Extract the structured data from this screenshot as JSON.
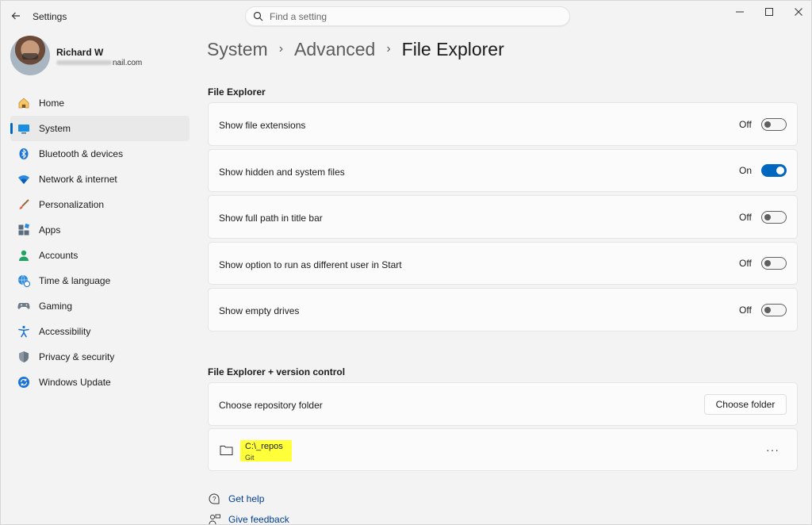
{
  "window": {
    "title": "Settings",
    "search_placeholder": "Find a setting"
  },
  "profile": {
    "name": "Richard W",
    "email_suffix": "nail.com"
  },
  "sidebar": {
    "items": [
      {
        "label": "Home",
        "icon": "home-icon",
        "active": false
      },
      {
        "label": "System",
        "icon": "system-icon",
        "active": true
      },
      {
        "label": "Bluetooth & devices",
        "icon": "bluetooth-icon",
        "active": false
      },
      {
        "label": "Network & internet",
        "icon": "wifi-icon",
        "active": false
      },
      {
        "label": "Personalization",
        "icon": "brush-icon",
        "active": false
      },
      {
        "label": "Apps",
        "icon": "apps-icon",
        "active": false
      },
      {
        "label": "Accounts",
        "icon": "accounts-icon",
        "active": false
      },
      {
        "label": "Time & language",
        "icon": "globe-clock-icon",
        "active": false
      },
      {
        "label": "Gaming",
        "icon": "gamepad-icon",
        "active": false
      },
      {
        "label": "Accessibility",
        "icon": "accessibility-icon",
        "active": false
      },
      {
        "label": "Privacy & security",
        "icon": "shield-icon",
        "active": false
      },
      {
        "label": "Windows Update",
        "icon": "update-icon",
        "active": false
      }
    ]
  },
  "breadcrumb": {
    "items": [
      "System",
      "Advanced",
      "File Explorer"
    ],
    "separator": "›"
  },
  "file_explorer": {
    "section_title": "File Explorer",
    "settings": [
      {
        "label": "Show file extensions",
        "state": "Off",
        "on": false
      },
      {
        "label": "Show hidden and system files",
        "state": "On",
        "on": true
      },
      {
        "label": "Show full path in title bar",
        "state": "Off",
        "on": false
      },
      {
        "label": "Show option to run as different user in Start",
        "state": "Off",
        "on": false
      },
      {
        "label": "Show empty drives",
        "state": "Off",
        "on": false
      }
    ]
  },
  "version_control": {
    "section_title": "File Explorer + version control",
    "choose_label": "Choose repository folder",
    "choose_button": "Choose folder",
    "repo_path": "C:\\_repos",
    "repo_type": "Git",
    "more_label": "···"
  },
  "links": {
    "help": "Get help",
    "feedback": "Give feedback"
  },
  "colors": {
    "accent": "#0067c0",
    "highlight": "#ffff3a",
    "link": "#003e92"
  }
}
